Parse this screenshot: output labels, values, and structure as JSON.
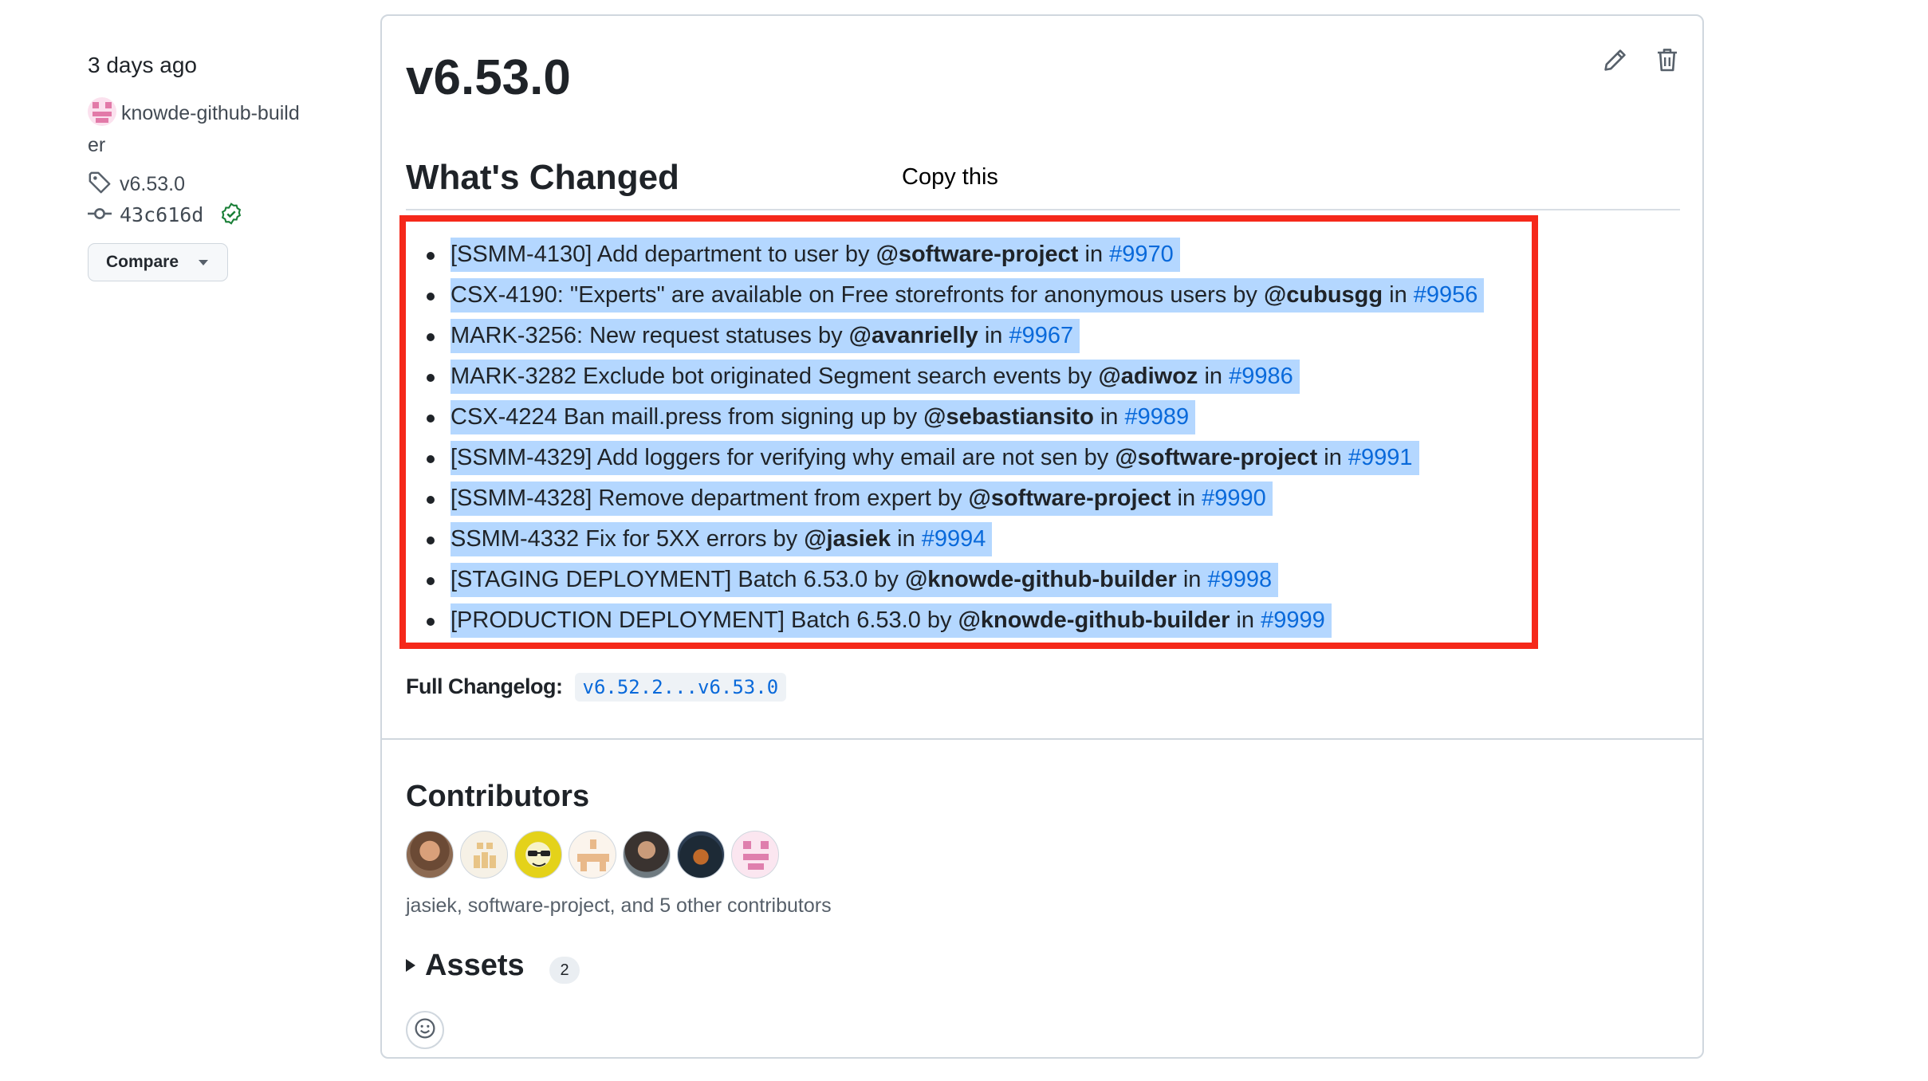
{
  "meta": {
    "timestamp": "3 days ago",
    "author_line1": "knowde-github-build",
    "author_line2": "er",
    "tag": "v6.53.0",
    "commit": "43c616d",
    "compare_label": "Compare"
  },
  "release": {
    "title": "v6.53.0",
    "section_heading": "What's Changed",
    "annotation": "Copy this",
    "changes": [
      {
        "text": "[SSMM-4130] Add department to user by ",
        "author": "@software-project",
        "mid": " in ",
        "pr": "#9970"
      },
      {
        "text": "CSX-4190: \"Experts\" are available on Free storefronts for anonymous users by ",
        "author": "@cubusgg",
        "mid": " in ",
        "pr": "#9956"
      },
      {
        "text": "MARK-3256: New request statuses by ",
        "author": "@avanrielly",
        "mid": " in ",
        "pr": "#9967"
      },
      {
        "text": "MARK-3282 Exclude bot originated Segment search events by ",
        "author": "@adiwoz",
        "mid": " in ",
        "pr": "#9986"
      },
      {
        "text": "CSX-4224 Ban maill.press from signing up by ",
        "author": "@sebastiansito",
        "mid": " in ",
        "pr": "#9989"
      },
      {
        "text": "[SSMM-4329] Add loggers for verifying why email are not sen by ",
        "author": "@software-project",
        "mid": " in ",
        "pr": "#9991"
      },
      {
        "text": "[SSMM-4328] Remove department from expert by ",
        "author": "@software-project",
        "mid": " in ",
        "pr": "#9990"
      },
      {
        "text": "SSMM-4332 Fix for 5XX errors by ",
        "author": "@jasiek",
        "mid": " in ",
        "pr": "#9994"
      },
      {
        "text": "[STAGING DEPLOYMENT] Batch 6.53.0 by ",
        "author": "@knowde-github-builder",
        "mid": " in ",
        "pr": "#9998"
      },
      {
        "text": "[PRODUCTION DEPLOYMENT] Batch 6.53.0 by ",
        "author": "@knowde-github-builder",
        "mid": " in ",
        "pr": "#9999"
      }
    ],
    "full_changelog_label": "Full Changelog:",
    "full_changelog_value": "v6.52.2...v6.53.0"
  },
  "contributors": {
    "heading": "Contributors",
    "summary": "jasiek, software-project, and 5 other contributors",
    "avatars": [
      "avatar-1",
      "avatar-2",
      "avatar-3",
      "avatar-4",
      "avatar-5",
      "avatar-6",
      "avatar-7"
    ]
  },
  "assets": {
    "heading": "Assets",
    "count": "2"
  },
  "colors": {
    "link": "#0969da",
    "selection": "#b4d7ff",
    "highlight_box": "#f5281a",
    "verified": "#1a7f37"
  }
}
